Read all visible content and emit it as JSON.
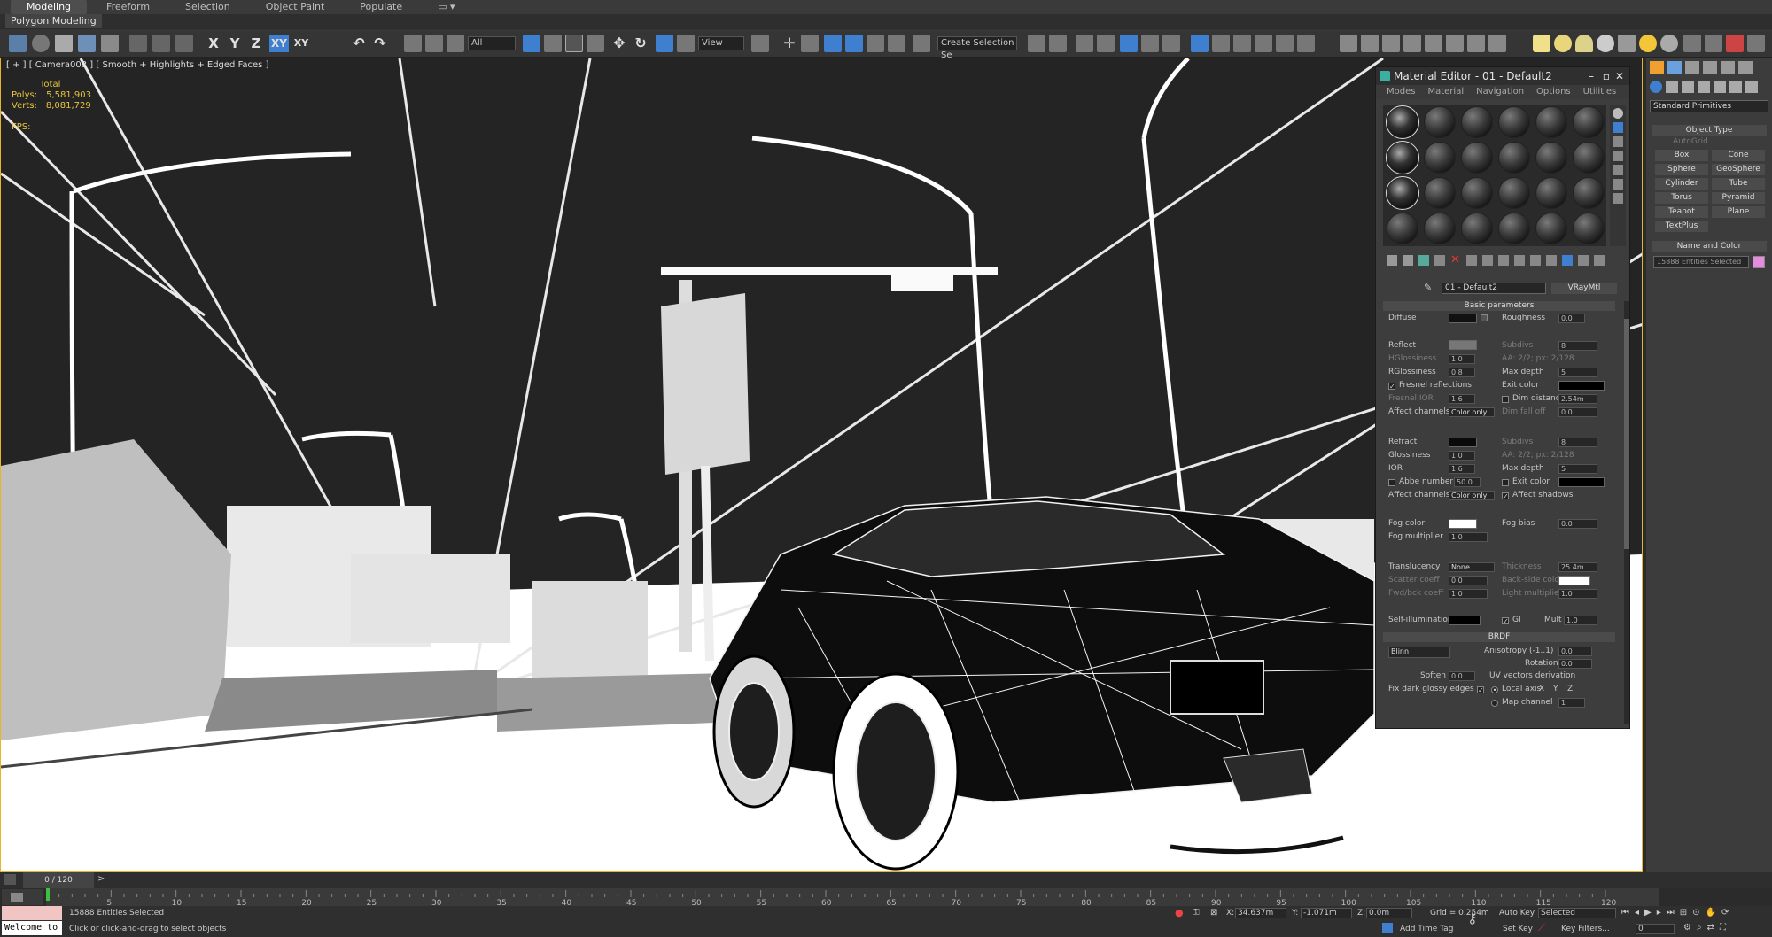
{
  "ribbon": {
    "tabs": [
      "Modeling",
      "Freeform",
      "Selection",
      "Object Paint",
      "Populate"
    ],
    "active_tab": "Modeling",
    "sub_label": "Polygon Modeling"
  },
  "toolbar": {
    "axis_x": "X",
    "axis_y": "Y",
    "axis_z": "Z",
    "axis_xy": "XY",
    "filter_value": "All",
    "refcoord_value": "View",
    "named_selection_value": "Create Selection Se"
  },
  "viewport": {
    "label": "[ + ] [ Camera003 ] [ Smooth + Highlights + Edged Faces ]",
    "stats": {
      "total_label": "Total",
      "polys_label": "Polys:",
      "polys_value": "5,581,903",
      "verts_label": "Verts:",
      "verts_value": "8,081,729",
      "fps_label": "FPS:"
    }
  },
  "command_panel": {
    "dropdown_value": "Standard Primitives",
    "object_type_header": "Object Type",
    "autogrid_label": "AutoGrid",
    "buttons": [
      "Box",
      "Cone",
      "Sphere",
      "GeoSphere",
      "Cylinder",
      "Tube",
      "Torus",
      "Pyramid",
      "Teapot",
      "Plane",
      "TextPlus"
    ],
    "name_color_header": "Name and Color",
    "name_value": "15888 Entities Selected",
    "object_color": "#e58be0"
  },
  "material_editor": {
    "title": "Material Editor - 01 - Default2",
    "menu": [
      "Modes",
      "Material",
      "Navigation",
      "Options",
      "Utilities"
    ],
    "material_name": "01 - Default2",
    "material_type": "VRayMtl",
    "basic_params_header": "Basic parameters",
    "diffuse_label": "Diffuse",
    "roughness_label": "Roughness",
    "roughness_value": "0.0",
    "reflect_label": "Reflect",
    "subdivs_label": "Subdivs",
    "subdivs_value": "8",
    "hglossiness_label": "HGlossiness",
    "hglossiness_value": "1.0",
    "aa_text": "AA: 2/2; px: 2/128",
    "rglossiness_label": "RGlossiness",
    "rglossiness_value": "0.8",
    "max_depth_label": "Max depth",
    "max_depth_value": "5",
    "fresnel_label": "Fresnel reflections",
    "exit_color_label": "Exit color",
    "fresnel_ior_label": "Fresnel IOR",
    "fresnel_ior_value": "1.6",
    "dim_distance_label": "Dim distance",
    "dim_distance_value": "2.54m",
    "affect_channels_label": "Affect channels",
    "affect_channels_value": "Color only",
    "dim_falloff_label": "Dim fall off",
    "dim_falloff_value": "0.0",
    "refract_label": "Refract",
    "refract_subdivs_value": "8",
    "glossiness_label": "Glossiness",
    "glossiness_value": "1.0",
    "refract_aa_text": "AA: 2/2; px: 2/128",
    "ior_label": "IOR",
    "ior_value": "1.6",
    "refract_max_depth_value": "5",
    "abbe_label": "Abbe number",
    "abbe_value": "50.0",
    "refract_exit_color_label": "Exit color",
    "affect_shadows_label": "Affect shadows",
    "fog_color_label": "Fog color",
    "fog_bias_label": "Fog bias",
    "fog_bias_value": "0.0",
    "fog_multiplier_label": "Fog multiplier",
    "fog_multiplier_value": "1.0",
    "translucency_label": "Translucency",
    "translucency_value": "None",
    "thickness_label": "Thickness",
    "thickness_value": "25.4m",
    "scatter_label": "Scatter coeff",
    "scatter_value": "0.0",
    "backside_label": "Back-side color",
    "fwdbck_label": "Fwd/bck coeff",
    "fwdbck_value": "1.0",
    "light_mult_label": "Light multiplier",
    "light_mult_value": "1.0",
    "self_illum_label": "Self-illumination",
    "gi_label": "GI",
    "mult_label": "Mult",
    "mult_value": "1.0",
    "brdf_header": "BRDF",
    "brdf_type": "Blinn",
    "anisotropy_label": "Anisotropy (-1..1)",
    "anisotropy_value": "0.0",
    "rotation_label": "Rotation",
    "rotation_value": "0.0",
    "soften_label": "Soften",
    "soften_value": "0.0",
    "uv_label": "UV vectors derivation",
    "fix_dark_label": "Fix dark glossy edges",
    "local_axis_label": "Local axis",
    "ax_x": "X",
    "ax_y": "Y",
    "ax_z": "Z",
    "map_channel_label": "Map channel",
    "map_channel_value": "1"
  },
  "timeline": {
    "frame_label": "0 / 120",
    "ticks": [
      "5",
      "10",
      "15",
      "20",
      "25",
      "30",
      "35",
      "40",
      "45",
      "50",
      "55",
      "60",
      "65",
      "70",
      "75",
      "80",
      "85",
      "90",
      "95",
      "100",
      "105",
      "110",
      "115",
      "120"
    ]
  },
  "status": {
    "selection_text": "15888 Entities Selected",
    "prompt_text": "Click or click-and-drag to select objects",
    "listener_text": "Welcome to",
    "x_label": "X:",
    "x_value": "34.637m",
    "y_label": "Y:",
    "y_value": "-1.071m",
    "z_label": "Z:",
    "z_value": "0.0m",
    "grid_text": "Grid = 0.254m",
    "add_time_tag": "Add Time Tag",
    "auto_key_label": "Auto Key",
    "auto_key_value": "Selected",
    "set_key_label": "Set Key",
    "key_filters_label": "Key Filters...",
    "frame_value": "0"
  }
}
